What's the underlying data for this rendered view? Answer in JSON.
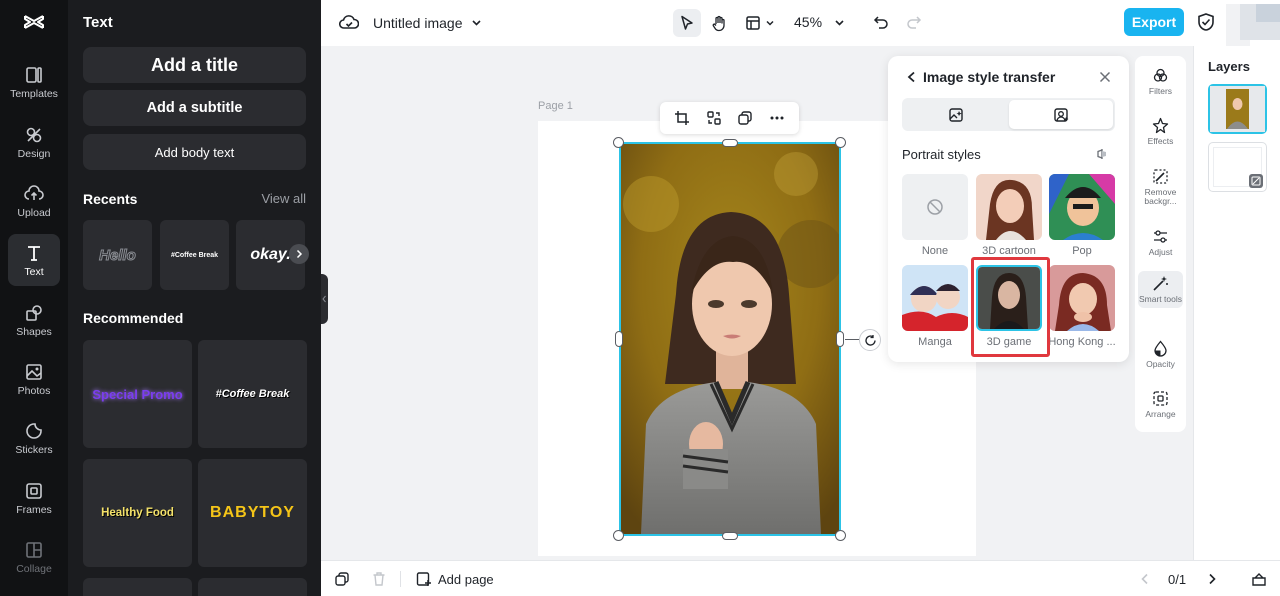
{
  "rail": {
    "items": [
      {
        "label": "Templates",
        "icon": "templates-icon"
      },
      {
        "label": "Design",
        "icon": "design-icon"
      },
      {
        "label": "Upload",
        "icon": "upload-icon"
      },
      {
        "label": "Text",
        "icon": "text-icon",
        "active": true
      },
      {
        "label": "Shapes",
        "icon": "shapes-icon"
      },
      {
        "label": "Photos",
        "icon": "photos-icon"
      },
      {
        "label": "Stickers",
        "icon": "stickers-icon"
      },
      {
        "label": "Frames",
        "icon": "frames-icon"
      },
      {
        "label": "Collage",
        "icon": "collage-icon"
      }
    ]
  },
  "text_panel": {
    "title": "Text",
    "add_title": "Add a title",
    "add_subtitle": "Add a subtitle",
    "add_body": "Add body text",
    "recents_header": "Recents",
    "view_all": "View all",
    "recents": [
      "Hello",
      "#Coffee Break",
      "okay."
    ],
    "recommended_header": "Recommended",
    "recommended": [
      "Special Promo",
      "#Coffee Break",
      "Healthy Food",
      "BABYTOY"
    ]
  },
  "topbar": {
    "doc_title": "Untitled image",
    "zoom": "45%",
    "export_label": "Export"
  },
  "canvas": {
    "page_label": "Page 1"
  },
  "style_panel": {
    "title": "Image style transfer",
    "section": "Portrait styles",
    "styles": [
      {
        "label": "None"
      },
      {
        "label": "3D cartoon"
      },
      {
        "label": "Pop"
      },
      {
        "label": "Manga"
      },
      {
        "label": "3D game",
        "selected": true
      },
      {
        "label": "Hong Kong ..."
      }
    ]
  },
  "right_tools": [
    {
      "label": "Filters",
      "icon": "filters-icon"
    },
    {
      "label": "Effects",
      "icon": "effects-icon"
    },
    {
      "label": "Remove backgr...",
      "icon": "remove-background-icon"
    },
    {
      "label": "Adjust",
      "icon": "adjust-icon"
    },
    {
      "label": "Smart tools",
      "icon": "smart-tools-icon",
      "active": true
    },
    {
      "label": "Opacity",
      "icon": "opacity-icon"
    },
    {
      "label": "Arrange",
      "icon": "arrange-icon"
    }
  ],
  "layers": {
    "title": "Layers"
  },
  "bottombar": {
    "add_page": "Add page",
    "page_counter": "0/1"
  },
  "colors": {
    "accent": "#19b4f0",
    "selection": "#2cc3e6",
    "highlight": "#e0383e"
  }
}
